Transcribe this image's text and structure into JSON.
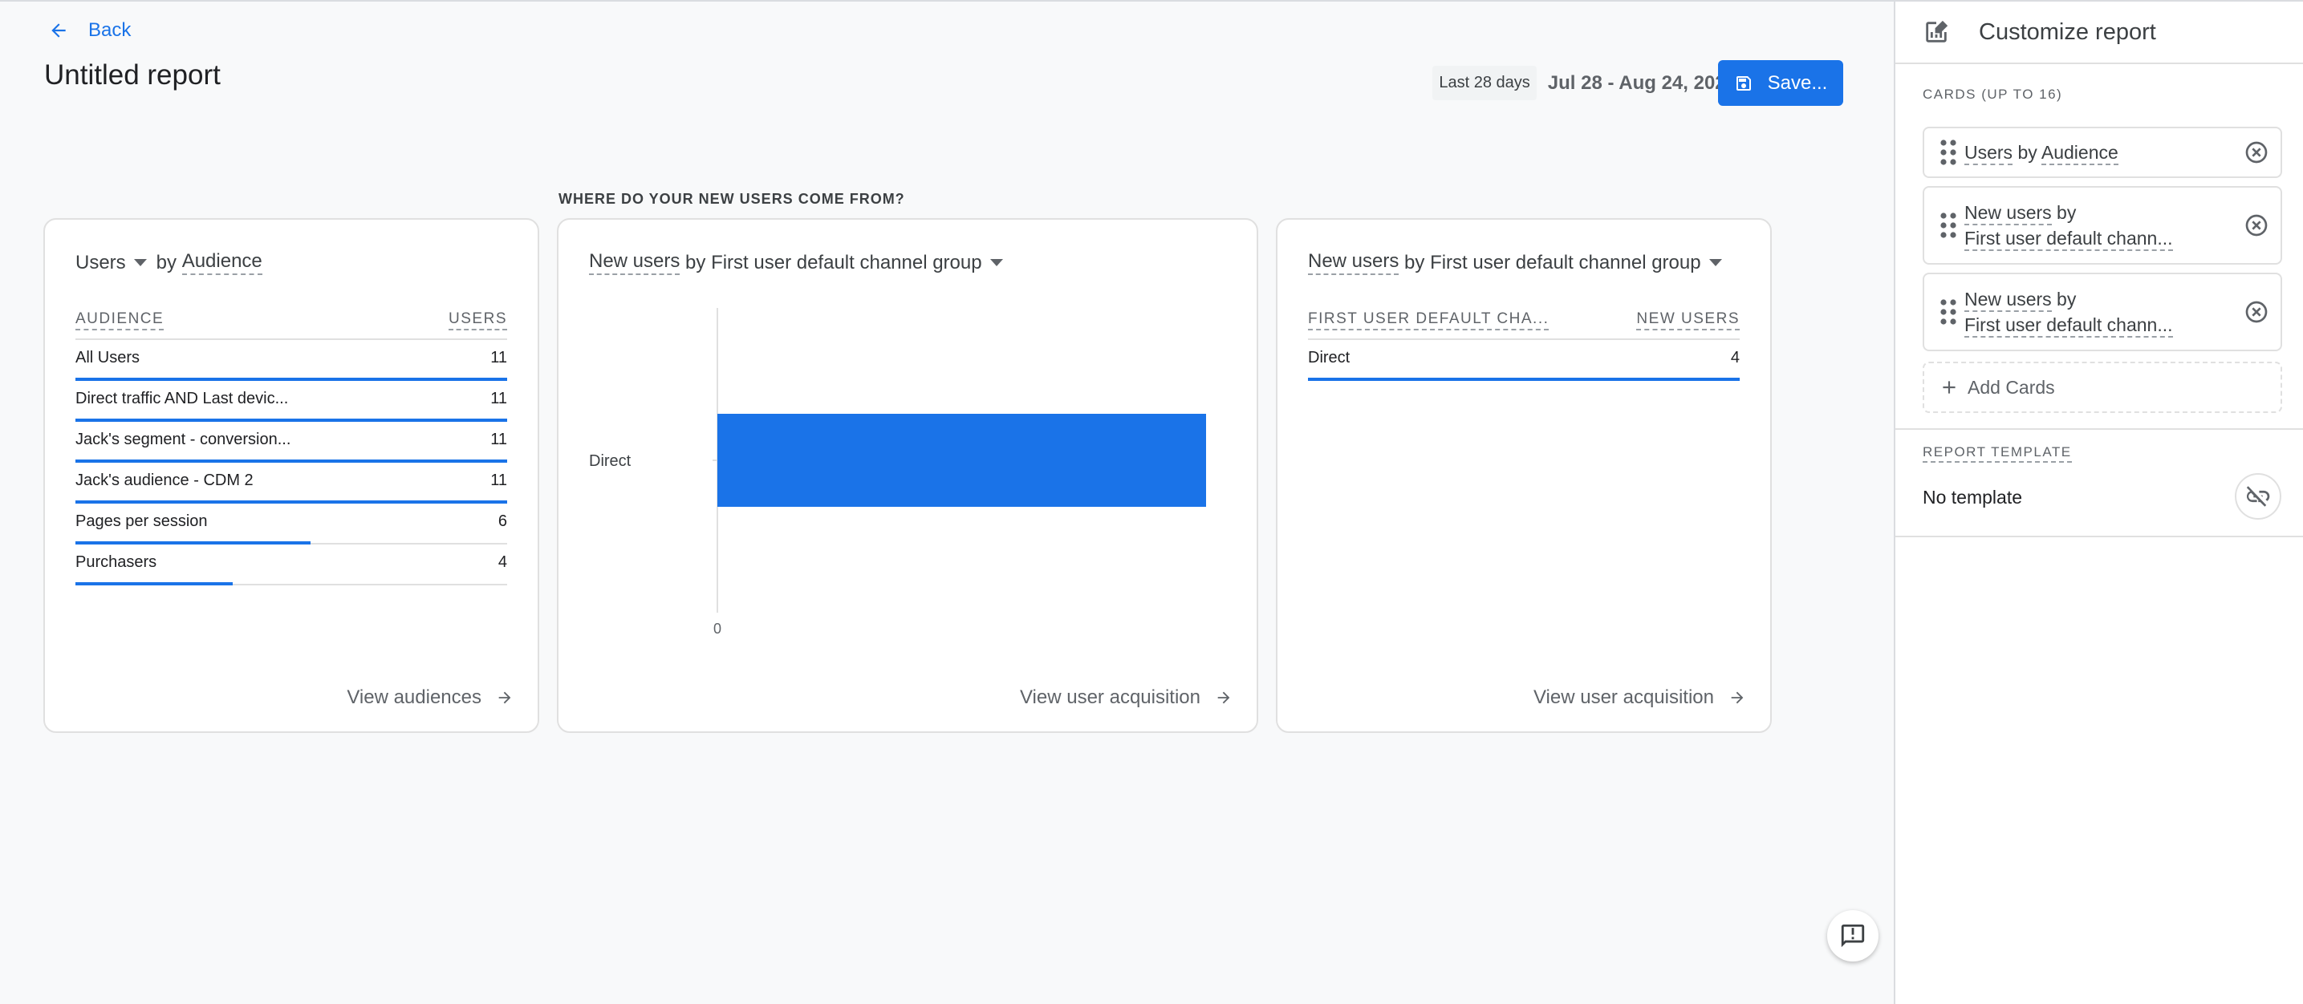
{
  "header": {
    "back_label": "Back",
    "title": "Untitled report",
    "date_preset": "Last 28 days",
    "date_range": "Jul 28 - Aug 24, 2023",
    "save_label": "Save..."
  },
  "section_label": "WHERE DO YOUR NEW USERS COME FROM?",
  "colors": {
    "accent": "#1a73e8",
    "text": "#202124",
    "muted": "#5f6368",
    "background": "#f8f9fa"
  },
  "cards": {
    "audience": {
      "metric": "Users",
      "by": "by",
      "dimension": "Audience",
      "col_dimension": "AUDIENCE",
      "col_metric": "USERS",
      "rows": [
        {
          "label": "All Users",
          "value": 11
        },
        {
          "label": "Direct traffic AND Last devic...",
          "value": 11
        },
        {
          "label": "Jack's segment - conversion...",
          "value": 11
        },
        {
          "label": "Jack's audience - CDM 2",
          "value": 11
        },
        {
          "label": "Pages per session",
          "value": 6
        },
        {
          "label": "Purchasers",
          "value": 4
        }
      ],
      "max_value": 11,
      "link_label": "View audiences"
    },
    "acquisition_chart": {
      "metric": "New users",
      "rest": "by First user default channel group",
      "link_label": "View user acquisition"
    },
    "acquisition_table": {
      "metric": "New users",
      "rest": "by First user default channel group",
      "col_dimension": "FIRST USER DEFAULT CHA...",
      "col_metric": "NEW USERS",
      "rows": [
        {
          "label": "Direct",
          "value": 4
        }
      ],
      "max_value": 4,
      "link_label": "View user acquisition"
    }
  },
  "chart_data": {
    "type": "bar",
    "orientation": "horizontal",
    "title": "New users by First user default channel group",
    "categories": [
      "Direct"
    ],
    "values": [
      4
    ],
    "x_tick_labels": [
      "0"
    ],
    "xlim": [
      0,
      4
    ],
    "grid": false,
    "color": "#1a73e8"
  },
  "panel": {
    "title": "Customize report",
    "cards_label": "CARDS (UP TO 16)",
    "cards": [
      {
        "line1_metric": "Users",
        "line1_rest": " by ",
        "line1_dim": "Audience",
        "line2": ""
      },
      {
        "line1_metric": "New users",
        "line1_rest": " by",
        "line1_dim": "",
        "line2": "First user default chann..."
      },
      {
        "line1_metric": "New users",
        "line1_rest": " by",
        "line1_dim": "",
        "line2": "First user default chann..."
      }
    ],
    "add_cards_label": "Add Cards",
    "template_label": "REPORT TEMPLATE",
    "template_value": "No template"
  },
  "icons": {
    "back": "arrow-left-icon",
    "save": "floppy-disk-icon",
    "view_link": "arrow-right-icon",
    "feedback": "feedback-icon",
    "panel_header": "edit-report-icon",
    "drag": "drag-handle-icon",
    "remove": "close-circle-icon",
    "add": "plus-icon",
    "unlink": "link-off-icon"
  }
}
